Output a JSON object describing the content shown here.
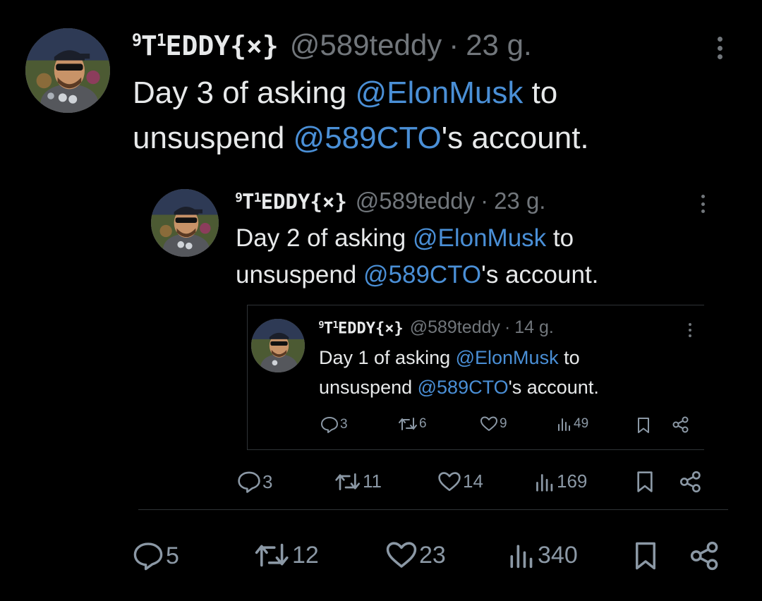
{
  "tweets": [
    {
      "name_prefix": "9",
      "name_t": "T",
      "name_sup": "1",
      "name_rest": "EDDY{×}",
      "handle": "@589teddy",
      "separator": "·",
      "time": "23 g.",
      "text_before": "Day 3 of asking ",
      "mention1": "@ElonMusk",
      "text_middle": " to",
      "text_line2_start": "unsuspend ",
      "mention2": "@589CTO",
      "text_end": "'s account.",
      "replies": "5",
      "reposts": "12",
      "likes": "23",
      "views": "340"
    },
    {
      "name_prefix": "9",
      "name_t": "T",
      "name_sup": "1",
      "name_rest": "EDDY{×}",
      "handle": "@589teddy",
      "separator": "·",
      "time": "23 g.",
      "text_before": "Day 2 of asking ",
      "mention1": "@ElonMusk",
      "text_middle": " to",
      "text_line2_start": "unsuspend ",
      "mention2": "@589CTO",
      "text_end": "'s account.",
      "replies": "3",
      "reposts": "11",
      "likes": "14",
      "views": "169"
    },
    {
      "name_prefix": "9",
      "name_t": "T",
      "name_sup": "1",
      "name_rest": "EDDY{×}",
      "handle": "@589teddy",
      "separator": "·",
      "time": "14 g.",
      "text_before": "Day 1 of asking ",
      "mention1": "@ElonMusk",
      "text_middle": " to",
      "text_line2_start": "unsuspend ",
      "mention2": "@589CTO",
      "text_end": "'s account.",
      "replies": "3",
      "reposts": "6",
      "likes": "9",
      "views": "49"
    }
  ],
  "icons": {
    "reply": "reply-icon",
    "repost": "repost-icon",
    "like": "heart-icon",
    "views": "views-icon",
    "bookmark": "bookmark-icon",
    "share": "share-icon",
    "more": "more-icon"
  },
  "colors": {
    "background": "#000000",
    "text": "#e7e9ea",
    "muted": "#71767b",
    "mention": "#4a8fd6",
    "avatar_ring": "#6a4aa8"
  }
}
